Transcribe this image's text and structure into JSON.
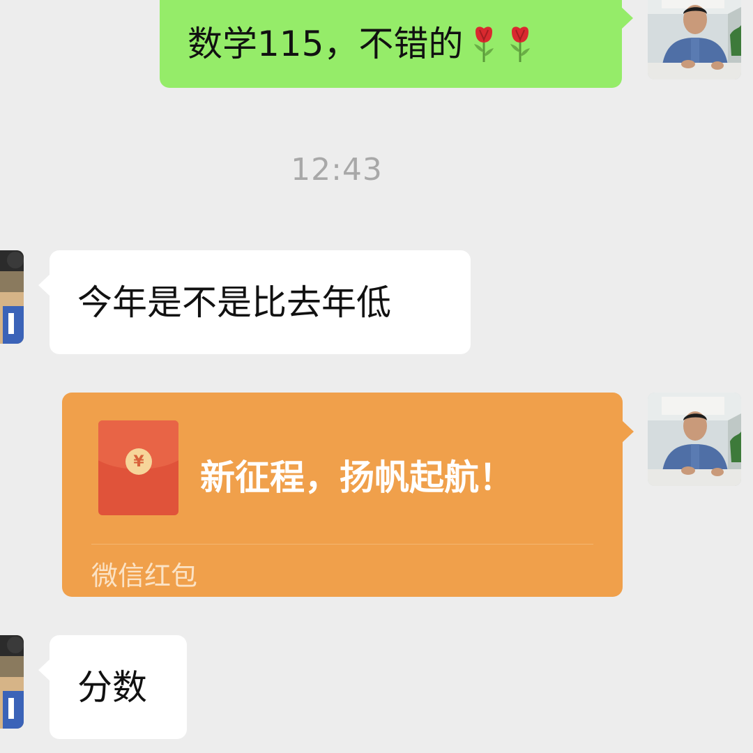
{
  "messages": [
    {
      "side": "right",
      "type": "text",
      "text": "数学115，不错的",
      "emoji": [
        "rose-icon",
        "rose-icon"
      ]
    },
    {
      "type": "timestamp",
      "text": "12:43"
    },
    {
      "side": "left",
      "type": "text",
      "text": "今年是不是比去年低"
    },
    {
      "side": "right",
      "type": "red_packet",
      "coin_symbol": "¥",
      "title": "新征程，扬帆起航！",
      "label": "微信红包"
    },
    {
      "side": "left",
      "type": "text",
      "text": "分数"
    }
  ],
  "colors": {
    "background": "#ededed",
    "sent_bubble": "#95ec69",
    "received_bubble": "#ffffff",
    "red_packet": "#f0a04b",
    "timestamp_text": "#a8a8a8"
  }
}
